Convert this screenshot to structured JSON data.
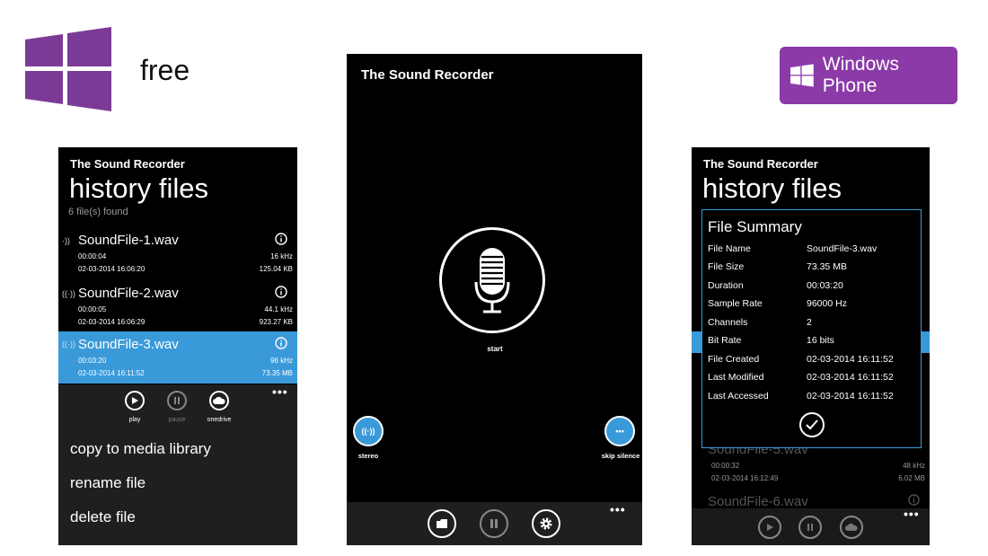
{
  "header": {
    "free_label": "free",
    "badge_label": "Windows Phone"
  },
  "left_screen": {
    "app_title": "The Sound Recorder",
    "page_title": "history files",
    "files_found": "6 file(s) found",
    "files": [
      {
        "name": "SoundFile-1.wav",
        "duration": "00:00:04",
        "date": "02-03-2014 16:06:20",
        "rate": "16 kHz",
        "size": "125.04 KB",
        "selected": false
      },
      {
        "name": "SoundFile-2.wav",
        "duration": "00:00:05",
        "date": "02-03-2014 16:06:29",
        "rate": "44.1 kHz",
        "size": "923.27 KB",
        "selected": false
      },
      {
        "name": "SoundFile-3.wav",
        "duration": "00:03:20",
        "date": "02-03-2014 16:11:52",
        "rate": "96 kHz",
        "size": "73.35 MB",
        "selected": true
      }
    ],
    "appbar": {
      "play": "play",
      "pause": "pause",
      "onedrive": "onedrive"
    },
    "menu": {
      "copy": "copy to media library",
      "rename": "rename file",
      "delete": "delete file"
    }
  },
  "middle_screen": {
    "app_title": "The Sound Recorder",
    "start_label": "start",
    "stereo_label": "stereo",
    "skip_label": "skip silence"
  },
  "right_screen": {
    "app_title": "The Sound Recorder",
    "page_title": "history files",
    "dialog": {
      "title": "File Summary",
      "rows": [
        {
          "label": "File Name",
          "value": "SoundFile-3.wav"
        },
        {
          "label": "File Size",
          "value": "73.35 MB"
        },
        {
          "label": "Duration",
          "value": "00:03:20"
        },
        {
          "label": "Sample Rate",
          "value": "96000 Hz"
        },
        {
          "label": "Channels",
          "value": "2"
        },
        {
          "label": "Bit Rate",
          "value": "16 bits"
        },
        {
          "label": "File Created",
          "value": "02-03-2014 16:11:52"
        },
        {
          "label": "Last Modified",
          "value": "02-03-2014 16:11:52"
        },
        {
          "label": "Last Accessed",
          "value": "02-03-2014 16:11:52"
        }
      ]
    },
    "behind_files": [
      {
        "name": "SoundFile-5.wav",
        "duration": "00:00:32",
        "date": "02-03-2014 16:12:49",
        "rate": "48 kHz",
        "size": "6.02 MB"
      },
      {
        "name": "SoundFile-6.wav"
      }
    ]
  },
  "colors": {
    "accent": "#3a9ad9",
    "windows_purple": "#8b3aa8",
    "appbar": "#1f1f1f"
  }
}
